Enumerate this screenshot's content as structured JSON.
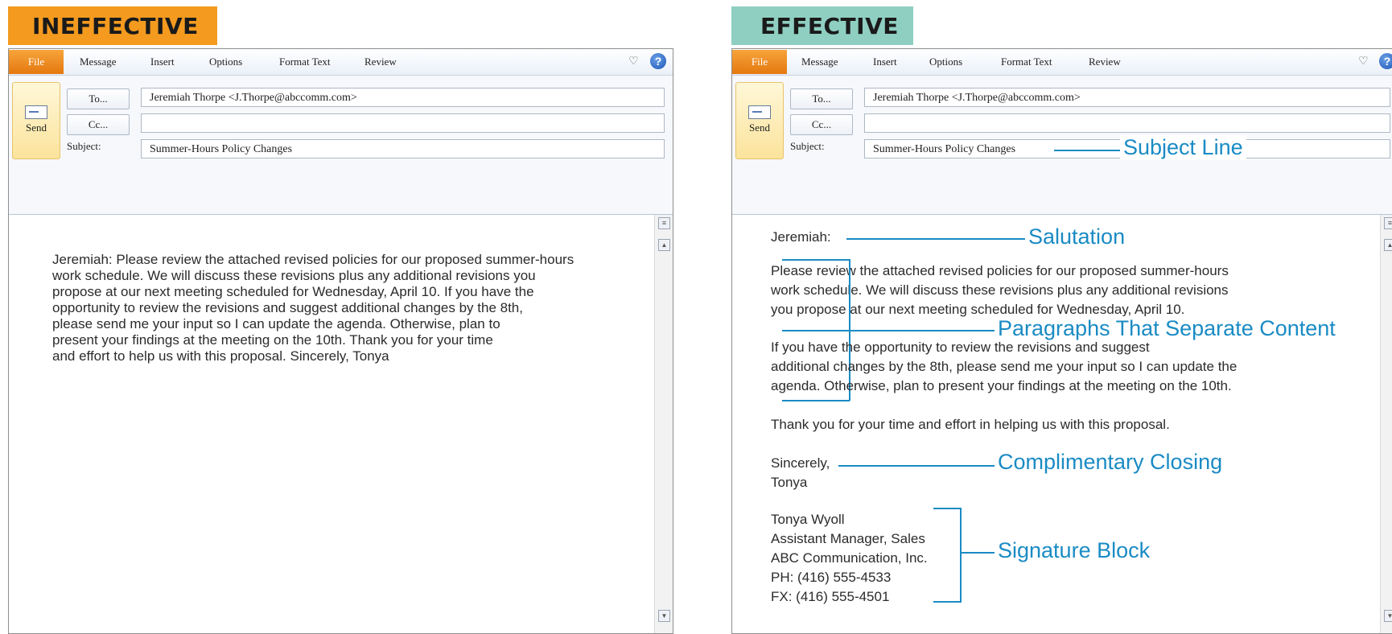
{
  "left": {
    "badge": "INEFFECTIVE",
    "ribbon": {
      "tabs": [
        "File",
        "Message",
        "Insert",
        "Options",
        "Format Text",
        "Review"
      ]
    },
    "header": {
      "send": "Send",
      "to_button": "To...",
      "cc_button": "Cc...",
      "subject_label": "Subject:",
      "to_value": "Jeremiah Thorpe <J.Thorpe@abccomm.com>",
      "cc_value": "",
      "subject_value": "Summer-Hours Policy Changes"
    },
    "body_lines": [
      "Jeremiah: Please review the attached revised policies for our proposed summer-hours",
      "work schedule. We will discuss these revisions plus any additional revisions you",
      "propose at our next meeting scheduled for Wednesday, April 10. If you have the",
      "opportunity to review the revisions and suggest additional changes by the 8th,",
      "please send me your input so I can update the agenda. Otherwise, plan to",
      "present your findings at the meeting on the 10th. Thank you for your time",
      "and effort to help us with this proposal. Sincerely, Tonya"
    ]
  },
  "right": {
    "badge": "EFFECTIVE",
    "ribbon": {
      "tabs": [
        "File",
        "Message",
        "Insert",
        "Options",
        "Format Text",
        "Review"
      ]
    },
    "header": {
      "send": "Send",
      "to_button": "To...",
      "cc_button": "Cc...",
      "subject_label": "Subject:",
      "to_value": "Jeremiah Thorpe <J.Thorpe@abccomm.com>",
      "cc_value": "",
      "subject_value": "Summer-Hours Policy Changes"
    },
    "salutation": "Jeremiah:",
    "paragraph1": [
      "Please review the attached revised policies for our proposed summer-hours",
      "work schedule. We will discuss these revisions plus any additional revisions",
      "you propose at our next meeting scheduled for Wednesday, April 10."
    ],
    "paragraph2": [
      "If you have the opportunity to review the revisions and suggest",
      "additional changes by the 8th, please send me your input so I can update the",
      "agenda. Otherwise, plan to present your findings at the meeting on the 10th."
    ],
    "paragraph3": "Thank you for your time and effort in helping us with this proposal.",
    "closing": [
      "Sincerely,",
      "Tonya"
    ],
    "signature": [
      "Tonya Wyoll",
      "Assistant Manager, Sales",
      "ABC Communication, Inc.",
      "PH: (416) 555-4533",
      "FX: (416) 555-4501"
    ],
    "annotations": {
      "subject_line": "Subject Line",
      "salutation": "Salutation",
      "paragraphs": "Paragraphs That Separate Content",
      "closing": "Complimentary Closing",
      "signature": "Signature Block"
    }
  },
  "colors": {
    "ineffective": "#f39a1f",
    "effective": "#8fcfc2",
    "annotation": "#1a8bc4",
    "file_tab": "#e4780f"
  },
  "icons": [
    "heart-icon",
    "help-icon",
    "send-icon",
    "scroll-up-icon",
    "scroll-down-icon"
  ]
}
